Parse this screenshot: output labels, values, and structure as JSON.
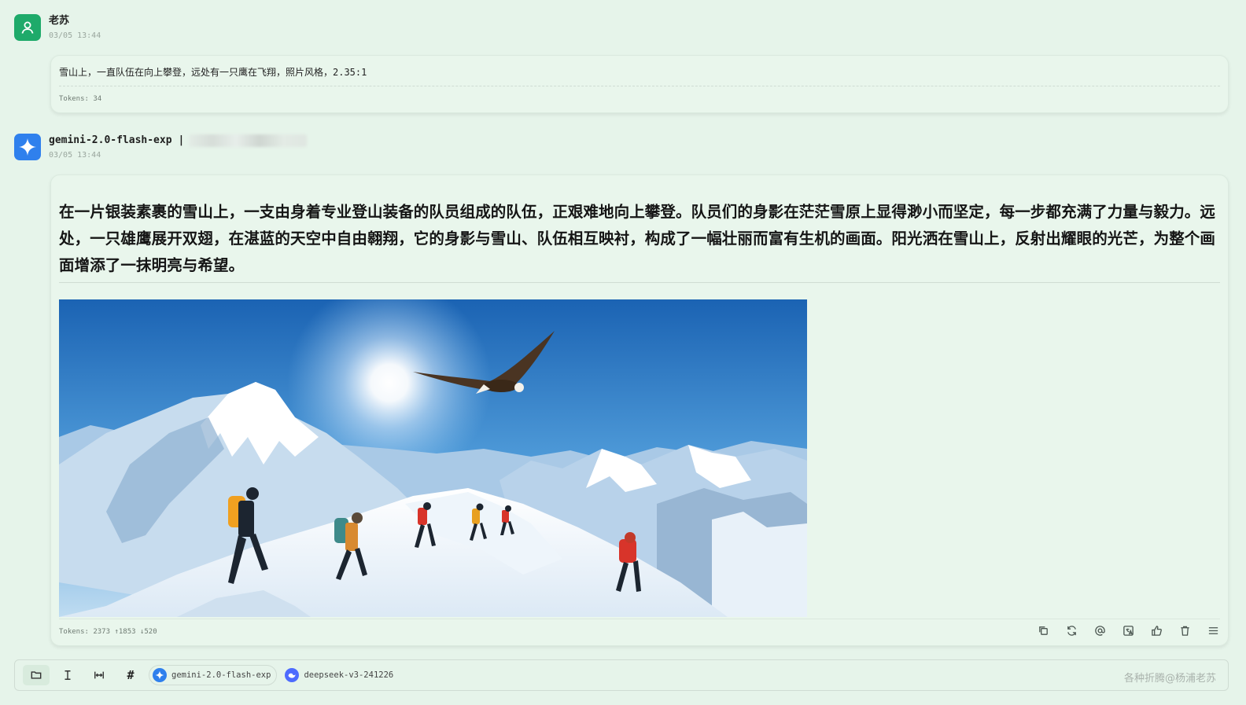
{
  "messages": {
    "user": {
      "name": "老苏",
      "time": "03/05 13:44",
      "text": "雪山上，一直队伍在向上攀登，远处有一只鹰在飞翔，照片风格，2.35:1",
      "tokens": "Tokens: 34"
    },
    "assistant": {
      "model": "gemini-2.0-flash-exp",
      "separator": "|",
      "time": "03/05 13:44",
      "text": "在一片银装素裹的雪山上，一支由身着专业登山装备的队员组成的队伍，正艰难地向上攀登。队员们的身影在茫茫雪原上显得渺小而坚定，每一步都充满了力量与毅力。远处，一只雄鹰展开双翅，在湛蓝的天空中自由翱翔，它的身影与雪山、队伍相互映衬，构成了一幅壮丽而富有生机的画面。阳光洒在雪山上，反射出耀眼的光芒，为整个画面增添了一抹明亮与希望。",
      "tokens": "Tokens: 2373 ↑1853 ↓520",
      "actions": [
        "copy-icon",
        "refresh-icon",
        "mention-icon",
        "translate-icon",
        "thumbs-up-icon",
        "trash-icon",
        "menu-icon"
      ]
    }
  },
  "inputbar": {
    "tools": [
      "folder-icon",
      "text-cursor-icon",
      "width-icon",
      "hash-icon"
    ],
    "hash_label": "#",
    "models": [
      {
        "label": "gemini-2.0-flash-exp",
        "selected": true
      },
      {
        "label": "deepseek-v3-241226",
        "selected": false
      }
    ]
  },
  "watermark": "各种折腾@杨浦老苏",
  "colors": {
    "background": "#e6f4ea",
    "user_avatar": "#1eaa6a",
    "bot_avatar": "#2f80ed",
    "deepseek": "#4d6bfe"
  }
}
